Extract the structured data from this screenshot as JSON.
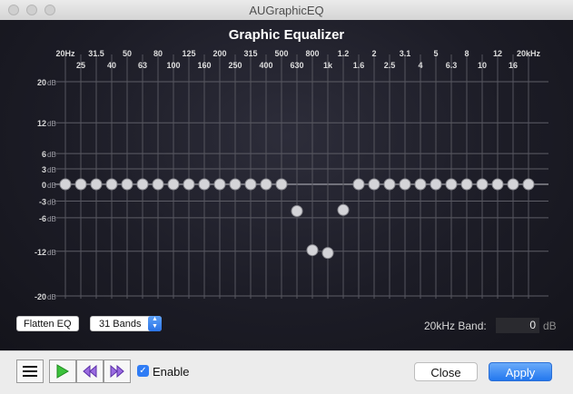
{
  "window": {
    "title": "AUGraphicEQ"
  },
  "eq": {
    "title": "Graphic Equalizer",
    "freq_top": [
      "20Hz",
      "31.5",
      "50",
      "80",
      "125",
      "200",
      "315",
      "500",
      "800",
      "1.2",
      "2",
      "3.1",
      "5",
      "8",
      "12",
      "20kHz"
    ],
    "freq_bottom": [
      "25",
      "40",
      "63",
      "100",
      "160",
      "250",
      "400",
      "630",
      "1k",
      "1.6",
      "2.5",
      "4",
      "6.3",
      "10",
      "16"
    ],
    "db_labels": [
      "20",
      "12",
      "6",
      "3",
      "0",
      "-3",
      "-6",
      "-12",
      "-20"
    ],
    "db_unit": "dB",
    "band_gains_db": [
      0,
      0,
      0,
      0,
      0,
      0,
      0,
      0,
      0,
      0,
      0,
      0,
      0,
      0,
      0,
      -4.8,
      -11.8,
      -12.3,
      -4.6,
      0,
      0,
      0,
      0,
      0,
      0,
      0,
      0,
      0,
      0,
      0,
      0
    ]
  },
  "controls": {
    "flatten_label": "Flatten EQ",
    "bands_label": "31 Bands",
    "band_field_label": "20kHz Band:",
    "band_field_value": "0",
    "band_field_unit": "dB"
  },
  "footer": {
    "enable_label": "Enable",
    "close_label": "Close",
    "apply_label": "Apply"
  },
  "colors": {
    "accent": "#2f7cf5",
    "panel_bg": "#1c1c26"
  }
}
